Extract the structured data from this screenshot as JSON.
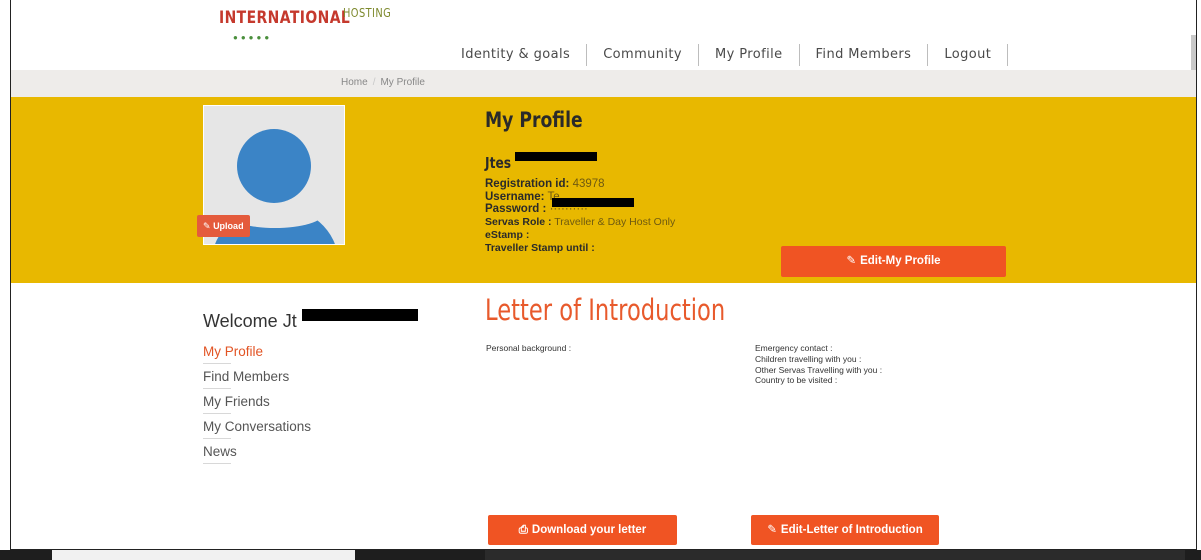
{
  "header": {
    "logo_word": "INTERNATIONAL",
    "logo_sub": "HOSTING",
    "logo_dots": "●●●●●"
  },
  "nav": {
    "items": [
      "Identity & goals",
      "Community",
      "My Profile",
      "Find Members",
      "Logout"
    ]
  },
  "breadcrumb": {
    "home": "Home",
    "separator": "/",
    "current": "My Profile"
  },
  "profile": {
    "title": "My Profile",
    "name": "Jtes",
    "upload_label": "Upload",
    "registration_label": "Registration id",
    "registration_value": "43978",
    "username_label": "Username",
    "username_value": "Te",
    "password_label": "Password :",
    "password_value": "··········",
    "role_label": "Servas Role",
    "role_value": "Traveller & Day Host Only",
    "estamp_label": "eStamp :",
    "stamp_label": "Traveller Stamp until :",
    "edit_button": "Edit-My Profile"
  },
  "sidebar": {
    "welcome": "Welcome Jt",
    "links": [
      "My Profile",
      "Find Members",
      "My Friends",
      "My Conversations",
      "News"
    ]
  },
  "letter": {
    "title": "Letter of Introduction",
    "left_fields": [
      "Personal background :"
    ],
    "right_fields": [
      "Emergency contact :",
      "Children travelling with you :",
      "Other Servas Travelling with you :",
      "Country to be visited :"
    ],
    "download_button": "Download your letter",
    "edit_button": "Edit-Letter of Introduction"
  },
  "colors": {
    "band": "#e8b800",
    "accent": "#f05423",
    "avatar": "#3b84c6"
  }
}
